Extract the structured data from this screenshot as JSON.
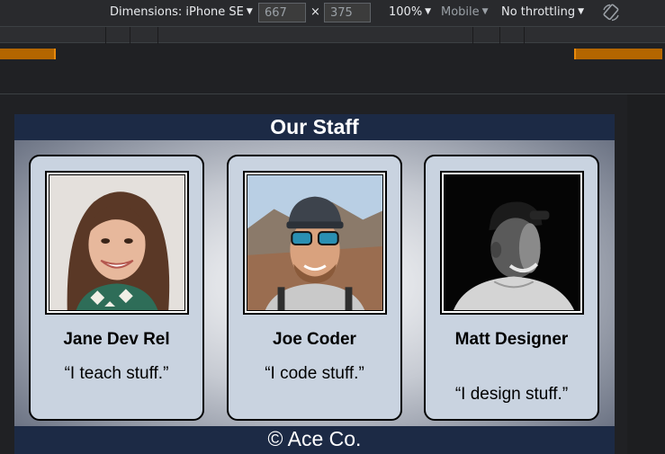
{
  "devtools": {
    "dimensions_label": "Dimensions: iPhone SE",
    "width": "667",
    "times": "×",
    "height": "375",
    "zoom": "100%",
    "mode": "Mobile",
    "throttling": "No throttling",
    "caret": "▼",
    "rotate_icon": "rotate-icon"
  },
  "page": {
    "title": "Our Staff",
    "footer": "© Ace Co.",
    "staff": [
      {
        "name": "Jane Dev Rel",
        "quote": "“I teach stuff.”",
        "photo": "portrait-photo"
      },
      {
        "name": "Joe Coder",
        "quote": "“I code stuff.”",
        "photo": "portrait-photo"
      },
      {
        "name": "Matt Designer",
        "quote": "“I design stuff.”",
        "photo": "portrait-photo"
      }
    ]
  },
  "colors": {
    "header_bg": "#1c2a45",
    "card_bg": "#c9d3e0",
    "breakpoint": "#b46600"
  }
}
